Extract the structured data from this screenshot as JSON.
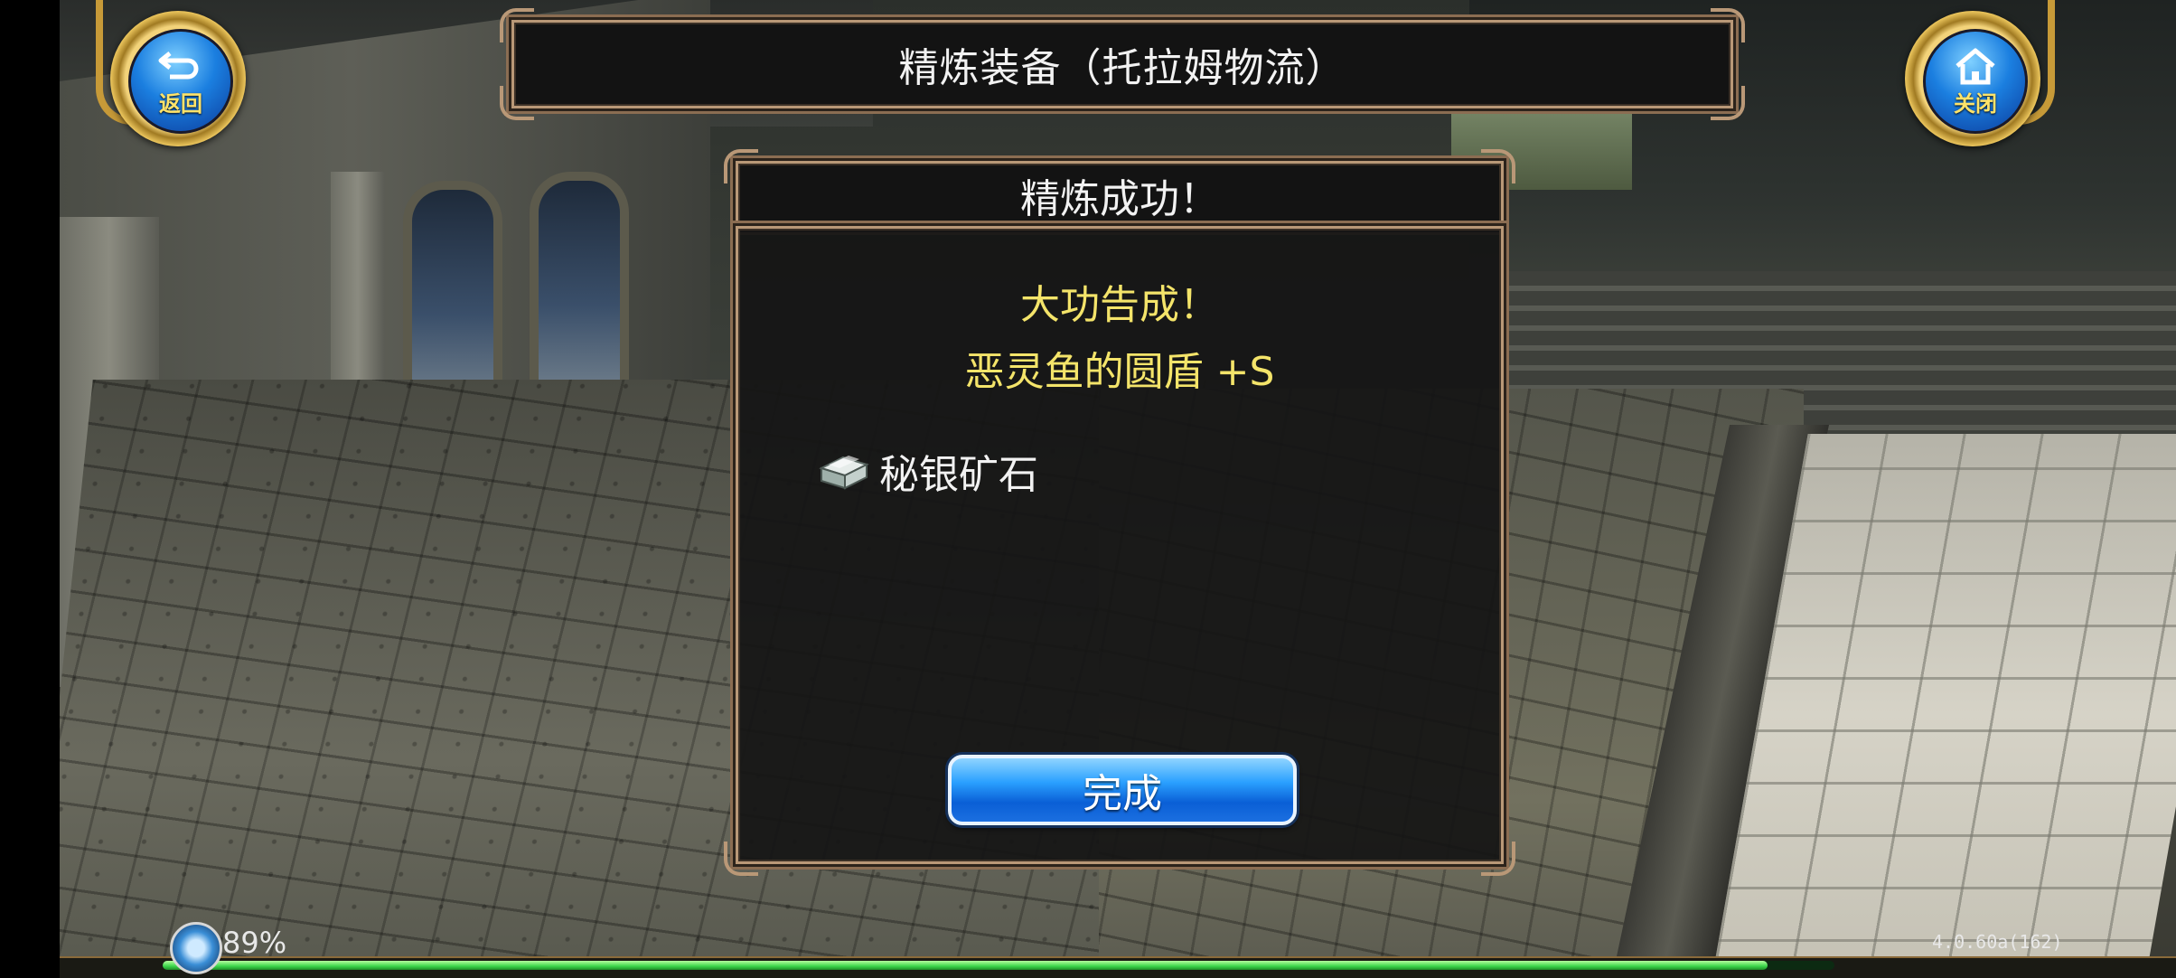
{
  "header": {
    "title": "精炼装备（托拉姆物流）",
    "back_label": "返回",
    "close_label": "关闭"
  },
  "dialog": {
    "title": "精炼成功！",
    "result_message": "大功告成！",
    "item_result": "恶灵鱼的圆盾 +S",
    "material_name": "秘银矿石",
    "done_label": "完成"
  },
  "status": {
    "percent_text": "89%",
    "version": "4.0.60a(162)",
    "exp_progress": 0.96
  },
  "colors": {
    "accent_yellow": "#f4e46a",
    "button_blue": "#2aa0ff",
    "frame_gold": "#b99877",
    "exp_green": "#3ad44a"
  },
  "icons": {
    "back": "return-arrow-icon",
    "close": "home-icon",
    "material": "silver-ingot-icon",
    "connection": "connection-orb-icon"
  }
}
